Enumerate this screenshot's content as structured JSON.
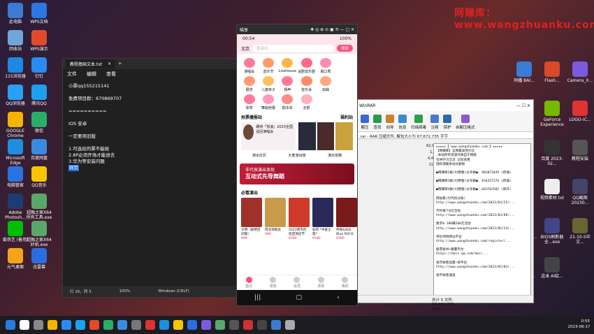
{
  "watermark": "网赚库：www.wangzhuanku.com",
  "desktop_left": [
    {
      "label": "此电脑",
      "color": "#3a7bd5"
    },
    {
      "label": "WPS文档",
      "color": "#2b78e4"
    },
    {
      "label": "回收站",
      "color": "#6fa7d8"
    },
    {
      "label": "WPS演示",
      "color": "#e24a2c"
    },
    {
      "label": "115浏览器",
      "color": "#1e88e5"
    },
    {
      "label": "钉钉",
      "color": "#2a8bf2"
    },
    {
      "label": "QQ浏览器",
      "color": "#2b9ff2"
    },
    {
      "label": "腾讯QQ",
      "color": "#1ea0f0"
    },
    {
      "label": "GOOGLE Chrome",
      "color": "#f4b400"
    },
    {
      "label": "微信",
      "color": "#2aae67"
    },
    {
      "label": "Microsoft Edge",
      "color": "#1d8fe0"
    },
    {
      "label": "百度网盘",
      "color": "#3a8be0"
    },
    {
      "label": "电脑管家",
      "color": "#2a72e0"
    },
    {
      "label": "QQ音乐",
      "color": "#f7c500"
    },
    {
      "label": "Adobe Photosh...",
      "color": "#1c3d72"
    },
    {
      "label": "超融之家X64 所有工具.exe",
      "color": "#59a86a"
    },
    {
      "label": "爱奇艺 (备用)",
      "color": "#00be06"
    },
    {
      "label": "超融之家X64 好机.exe",
      "color": "#59a86a"
    },
    {
      "label": "元气桌面",
      "color": "#f2a51a"
    },
    {
      "label": "迅雷幕",
      "color": "#2b6de0"
    }
  ],
  "desktop_right": [
    {
      "label": "同播 BAI...",
      "color": "#3a7bd5"
    },
    {
      "label": "Flash...",
      "color": "#d84a2a"
    },
    {
      "label": "Camera_X...",
      "color": "#7a5be0"
    },
    {
      "label": "gongsi...",
      "color": "#777"
    },
    {
      "label": "GeForce Experience",
      "color": "#76b900"
    },
    {
      "label": "LOGO-IC...",
      "color": "#d33"
    },
    {
      "label": "注册机及...",
      "color": "#888"
    },
    {
      "label": "百度 2023-02...",
      "color": "#333"
    },
    {
      "label": "教程安装",
      "color": "#555"
    },
    {
      "label": "QQ截图2023...",
      "color": "#445"
    },
    {
      "label": "视频素材.txt",
      "color": "#eee"
    },
    {
      "label": "QQ截图 20230...",
      "color": "#446"
    },
    {
      "label": "鼠合适配器...",
      "color": "#555"
    },
    {
      "label": "BIOS刷新器全...exe",
      "color": "#448"
    },
    {
      "label": "21-10-5中文...",
      "color": "#663"
    },
    {
      "label": "LOGO-IC...",
      "color": "#c33"
    },
    {
      "label": "这本 AI绘...",
      "color": "#444"
    }
  ],
  "notepad": {
    "tab_title": "教程基础文本.txt",
    "menu": [
      "文件",
      "编辑",
      "查看"
    ],
    "lines": [
      "小票qq155215141",
      "",
      "免费项目群：670869707",
      "",
      "==========",
      "",
      "IOS    安卓",
      "",
      "一定要用旧版",
      "",
      "1.可选段的票不能抢",
      "2.8P必须开场才能进去",
      "3.华为等安装问题"
    ],
    "selected_line": "网页",
    "status": [
      "行 16，列 3",
      "100%",
      "Windows (CRLF)",
      "UTF-8"
    ]
  },
  "winrar": {
    "title": "WinRAR",
    "toolbar": [
      "解压",
      "查找",
      "向导",
      "信息",
      "扫描病毒",
      "注释",
      "保护",
      "自解压格式"
    ],
    "path": ".rar - RAR 压缩文件, 解包大小为 67,672,735 字节",
    "nums": [
      "62,9",
      "1,",
      "4,4",
      "11"
    ],
    "comment": [
      "★★★★★【 www.wangzhuanku.com 】★★★★★",
      "  【网赚库】全网最高性价比",
      "  ,本站所有资源均来自于网络",
      "  仅供学习交流  切勿商用",
      "  侵权请联系站长删除",
      "",
      "●网赚库2群(付费版)分享群●: 903872039 (跨满)",
      "",
      "●网赚库3群(付费版)分享群●: 834257276 (跨满)",
      "",
      "●网赚库4群(付费版)分享群●: 663763582 (新开)",
      "",
      "网站看(付代扣分账)",
      "http://www.wangzhuanku.com/2023/03/25/...",
      "",
      "节约每个0元活动",
      "http://www.wangzhuanku.com/2023/03/09/...",
      "",
      "数字0-100赚200元活动",
      "http://www.wangzhuanku.com/2023/02/24/...",
      "",
      "券码项目网址平台",
      "http://www.wangzhuanku.com/register/...",
      "",
      "股票秘书+藤蔓平台",
      "https://docs.qq.com/doc/...",
      "",
      "纸币秘者加量+单平台",
      "http://www.wangzhuanku.com/2023/02/03/...",
      "",
      "纸币秘者通道"
    ],
    "status": "总计 5 文件, 67,672,735 字节"
  },
  "phone": {
    "app_name": "喵享",
    "time": "00:54",
    "battery": "100%",
    "city": "北京",
    "search_placeholder": "搜演出",
    "search_btn": "搜索",
    "categories": [
      {
        "label": "演唱会",
        "color": "#ff7a9a"
      },
      {
        "label": "音乐节",
        "color": "#ff9a6a"
      },
      {
        "label": "Livehouse",
        "color": "#ffb74a"
      },
      {
        "label": "话剧音乐剧",
        "color": "#ff6a8a"
      },
      {
        "label": "脱口秀",
        "color": "#ff8ab0"
      },
      {
        "label": "",
        "color": "#fff"
      },
      {
        "label": "展览",
        "color": "#ff9a7a"
      },
      {
        "label": "儿童亲子",
        "color": "#ffc060"
      },
      {
        "label": "相声",
        "color": "#ff7a9a"
      },
      {
        "label": "音乐会",
        "color": "#ff8a6a"
      },
      {
        "label": "戏曲",
        "color": "#ffaa7a"
      },
      {
        "label": "",
        "color": "#fff"
      },
      {
        "label": "体育",
        "color": "#ff7a9a"
      },
      {
        "label": "舞蹈芭蕾",
        "color": "#ff9ab8"
      },
      {
        "label": "剧本杀",
        "color": "#ff8a8a"
      },
      {
        "label": "全部",
        "color": "#ffb0c0"
      },
      {
        "label": "",
        "color": "#fff"
      },
      {
        "label": "",
        "color": "#fff"
      }
    ],
    "sections": {
      "left": "抢票播报站",
      "right": "福利站"
    },
    "card_text": "期待「热浪」2023全国巡回演唱会",
    "mini": [
      {
        "label": "演出日历",
        "sub": "每日演出不停"
      },
      {
        "label": "大麦演出榜",
        "sub": ""
      },
      {
        "label": "演出攻略",
        "sub": ""
      }
    ],
    "banner": {
      "l1": "非代表演出发现",
      "l2": "互动式先导舞蹈"
    },
    "must_see": "必看演出",
    "posters": [
      {
        "t": "文明（剧情空间版）",
        "p": "¥99",
        "c": "#a0302a"
      },
      {
        "t": "周深演唱会",
        "p": "¥80",
        "c": "#c89a4a"
      },
      {
        "t": "2023周杰伦巡回演出节",
        "p": "¥280",
        "c": "#d03a2a"
      },
      {
        "t": "如何 *中金之旅*",
        "p": "¥180",
        "c": "#2a2a5a"
      },
      {
        "t": "传奇&乐队 Blue ROCK",
        "p": "¥380",
        "c": "#7a1a1a"
      }
    ],
    "bottom": [
      "首页",
      "发现",
      "会员",
      "票夹",
      "我的"
    ]
  },
  "taskbar": {
    "time": "0:55",
    "date": "2023-06-1?"
  }
}
